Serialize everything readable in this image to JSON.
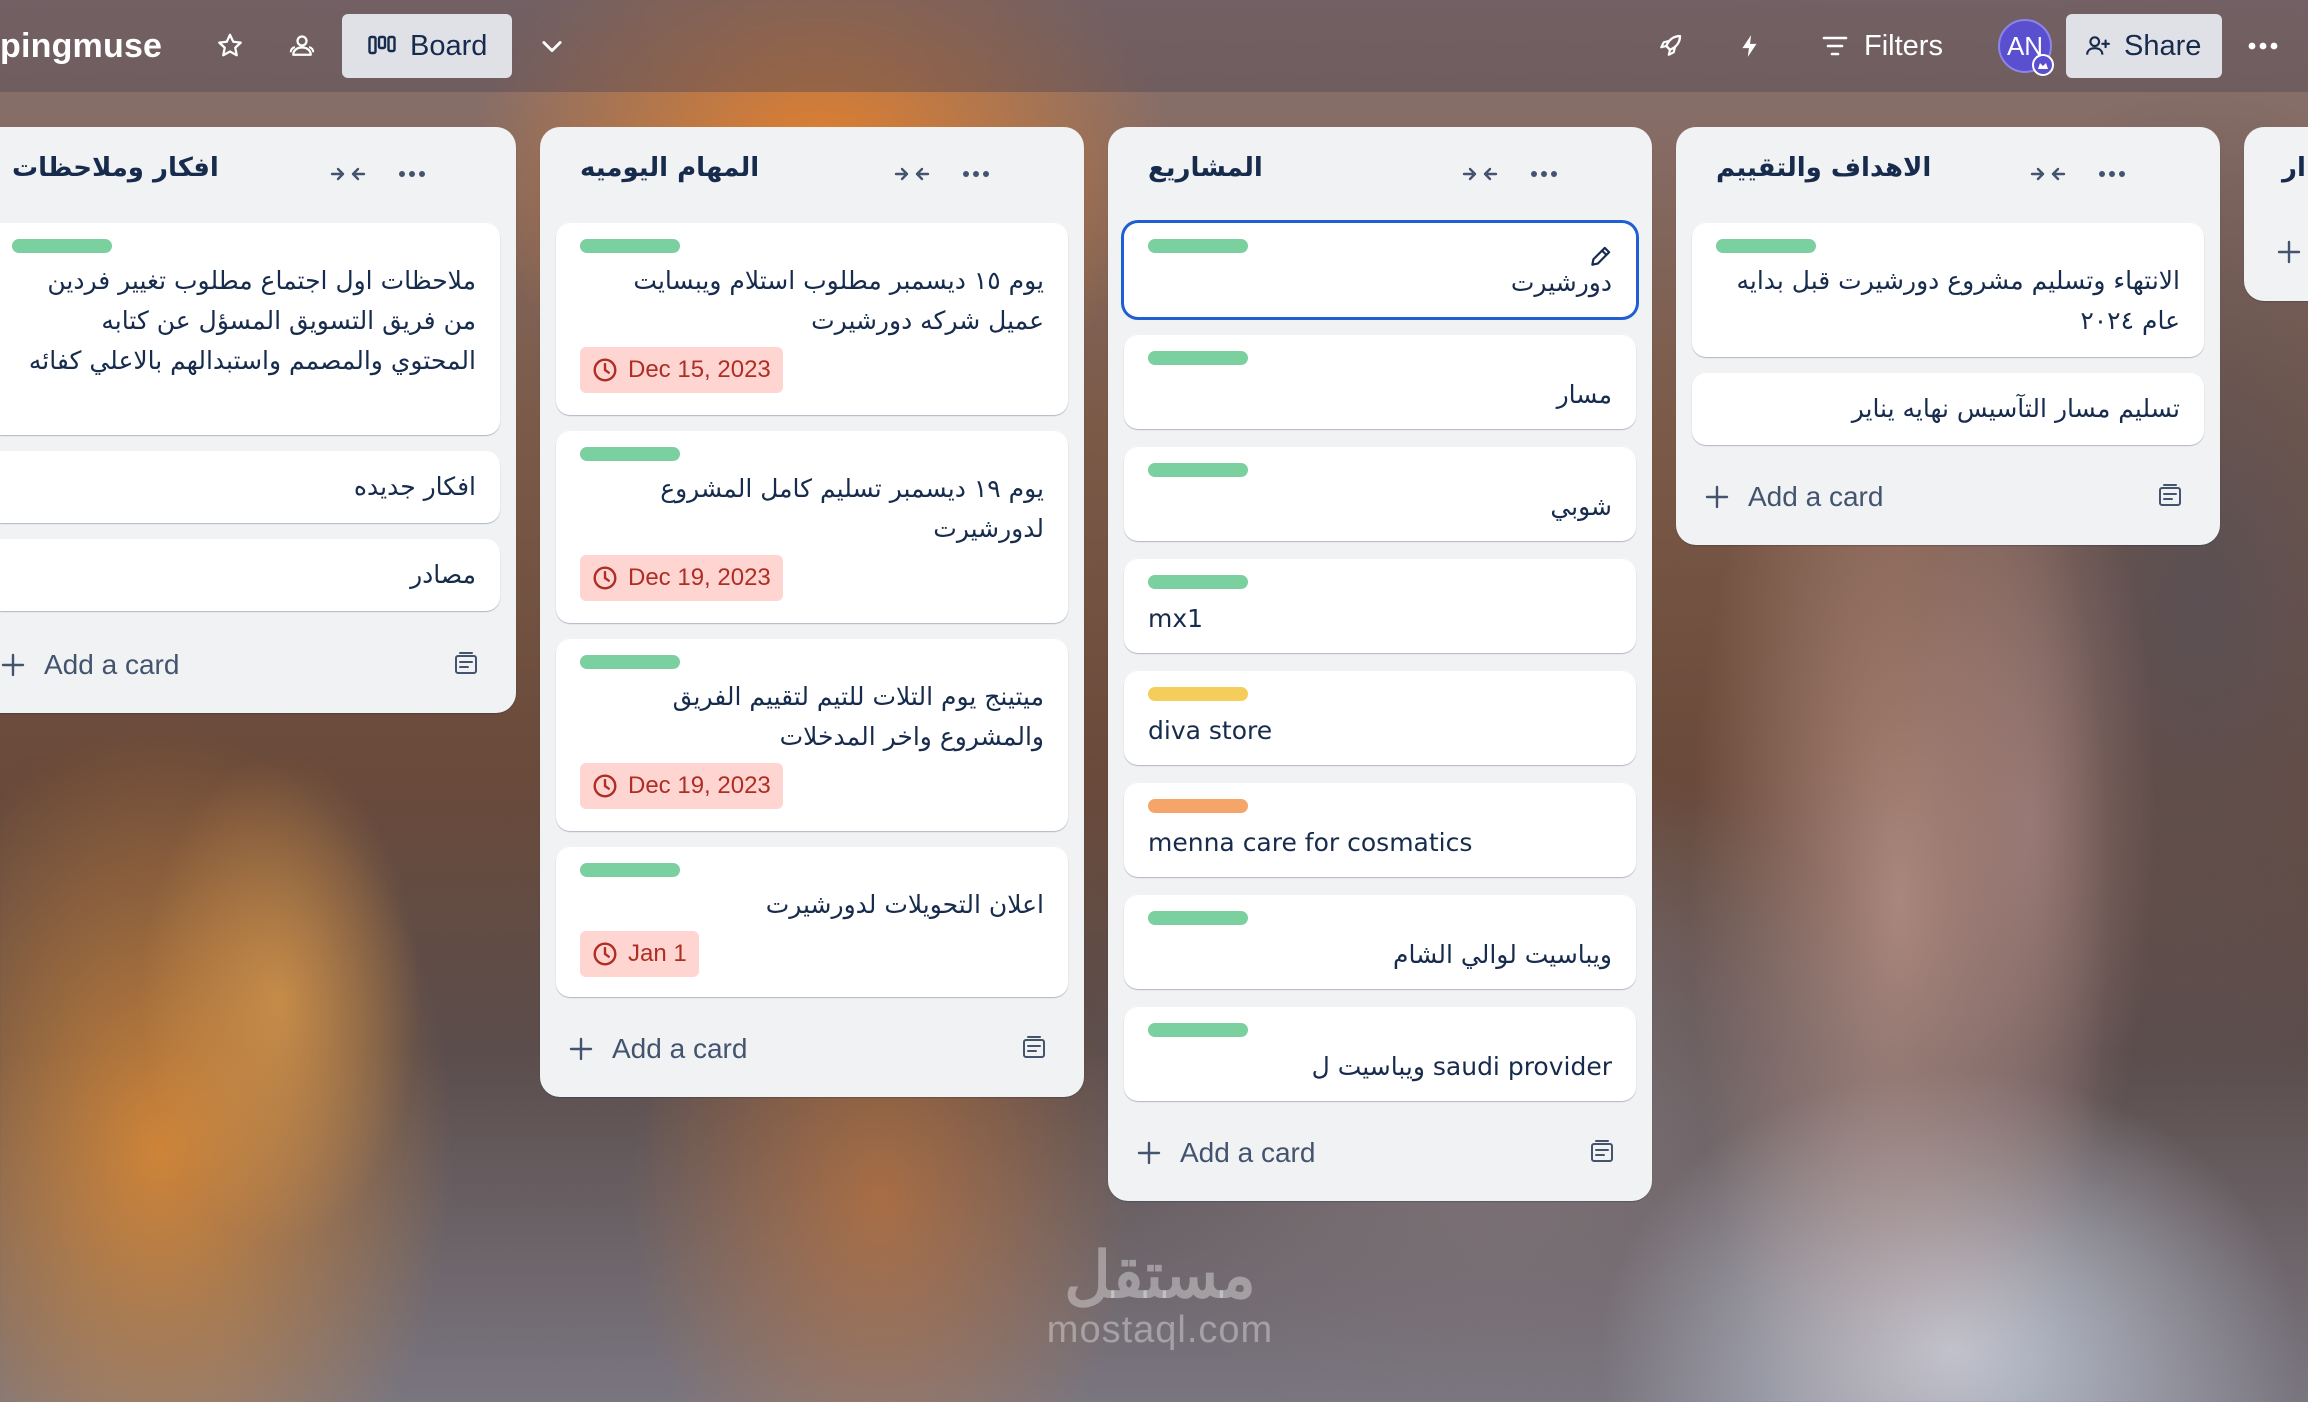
{
  "header": {
    "board_title": "pingmuse",
    "view_label": "Board",
    "filters_label": "Filters",
    "avatar_initials": "AN",
    "share_label": "Share"
  },
  "colors": {
    "label_green": "#7bd0a0",
    "label_yellow": "#f5cd5b",
    "label_orange": "#f5a46a",
    "due_bg": "#ffd5d2",
    "due_text": "#ae2e24",
    "selected_border": "#1f5fd1"
  },
  "lists": [
    {
      "title": "افكار وملاحظات",
      "add_card_label": "Add a card",
      "cards": [
        {
          "label": "green",
          "text": "ملاحظات اول اجتماع مطلوب تغيير فردين من فريق التسويق المسؤل عن كتابه المحتوي والمصمم واستبدالهم بالاعلي كفائه"
        },
        {
          "text": "افكار جديده"
        },
        {
          "text": "مصادر"
        }
      ]
    },
    {
      "title": "المهام اليوميه",
      "add_card_label": "Add a card",
      "cards": [
        {
          "label": "green",
          "text": "يوم ١٥ ديسمبر مطلوب استلام ويبسايت عميل شركه دورشيرت",
          "due": "Dec 15, 2023"
        },
        {
          "label": "green",
          "text": "يوم ١٩ ديسمبر تسليم كامل المشروع لدورشيرت",
          "due": "Dec 19, 2023"
        },
        {
          "label": "green",
          "text": "ميتينج يوم التلات للتيم لتقييم الفريق والمشروع واخر المدخلات",
          "due": "Dec 19, 2023"
        },
        {
          "label": "green",
          "text": "اعلان التحويلات لدورشيرت",
          "due": "Jan 1"
        }
      ]
    },
    {
      "title": "المشاريع",
      "add_card_label": "Add a card",
      "cards": [
        {
          "label": "green",
          "text": "دورشيرت"
        },
        {
          "label": "green",
          "text": "مسار"
        },
        {
          "label": "green",
          "text": "شوبي"
        },
        {
          "label": "green",
          "text": "mx1"
        },
        {
          "label": "yellow",
          "text": "diva store"
        },
        {
          "label": "orange",
          "text": "menna care for cosmatics"
        },
        {
          "label": "green",
          "text": "ويباسيت لوالي الشام"
        },
        {
          "label": "green",
          "text": "saudi provider ويباسيت ل"
        }
      ]
    },
    {
      "title": "الاهداف والتقييم",
      "add_card_label": "Add a card",
      "cards": [
        {
          "label": "green",
          "text": "الانتهاء وتسليم مشروع دورشيرت قبل بدايه عام ٢٠٢٤"
        },
        {
          "text": "تسليم مسار التآسيس نهايه يناير"
        }
      ]
    },
    {
      "title": "ار"
    }
  ],
  "watermark": {
    "arabic": "مستقل",
    "latin": "mostaql.com"
  }
}
